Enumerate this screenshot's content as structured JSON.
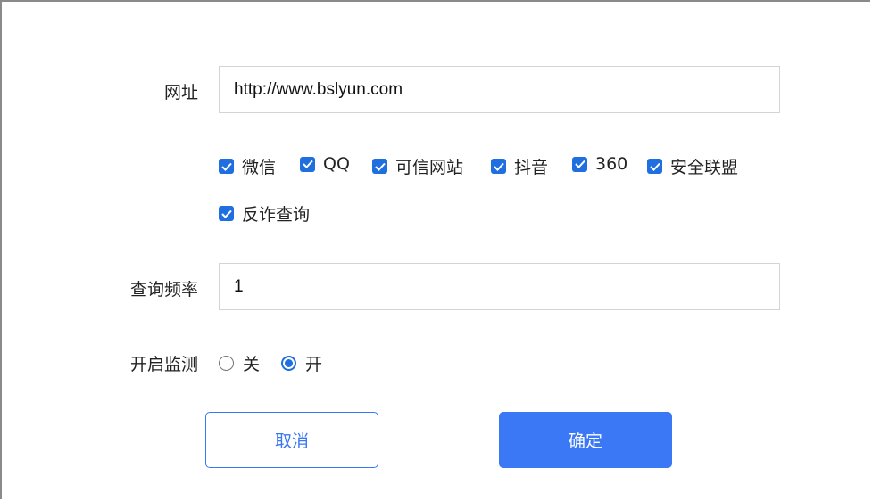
{
  "form": {
    "url_label": "网址",
    "url_value": "http://www.bslyun.com",
    "platforms": [
      {
        "label": "微信",
        "checked": true
      },
      {
        "label": "QQ",
        "checked": true
      },
      {
        "label": "可信网站",
        "checked": true
      },
      {
        "label": "抖音",
        "checked": true
      },
      {
        "label": "360",
        "checked": true
      },
      {
        "label": "安全联盟",
        "checked": true
      },
      {
        "label": "反诈查询",
        "checked": true
      }
    ],
    "frequency_label": "查询频率",
    "frequency_value": "1",
    "monitor_label": "开启监测",
    "monitor_options": [
      {
        "label": "关",
        "selected": false
      },
      {
        "label": "开",
        "selected": true
      }
    ]
  },
  "buttons": {
    "cancel_label": "取消",
    "confirm_label": "确定"
  },
  "colors": {
    "accent": "#3b78f6",
    "checkbox": "#1f6fe0"
  }
}
